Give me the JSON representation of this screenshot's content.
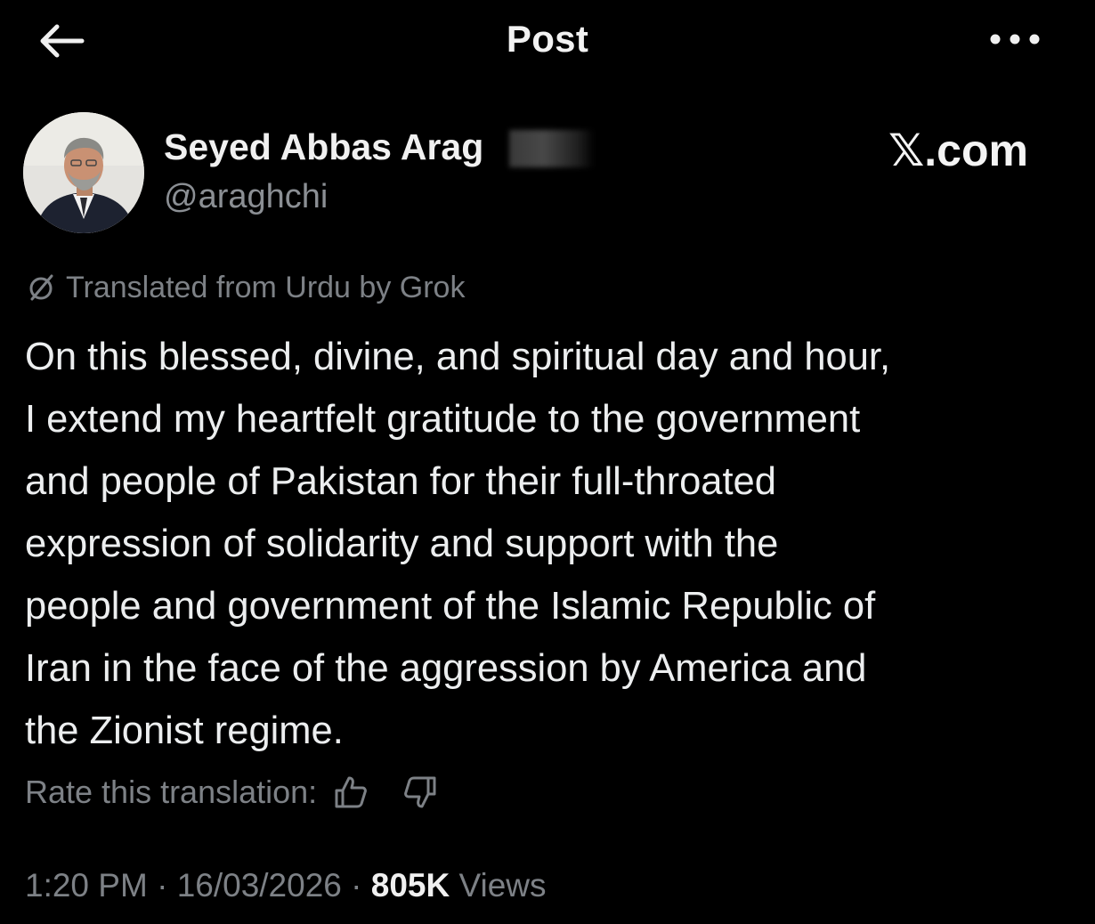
{
  "header": {
    "title": "Post",
    "back_icon": "arrow-left-icon",
    "more_icon": "more-horizontal-icon"
  },
  "author": {
    "name": "Seyed Abbas Arag",
    "handle": "@araghchi"
  },
  "watermark": "𝕏.com",
  "translation_notice": "Translated from Urdu by Grok",
  "post_lines": [
    "On this blessed, divine, and spiritual day and hour,",
    "I extend my heartfelt gratitude to the government",
    "and people of Pakistan for their full-throated",
    "expression of solidarity and support with the",
    "people and government of the Islamic Republic of",
    "Iran in the face of the aggression by America and",
    "the Zionist regime."
  ],
  "rating": {
    "label": "Rate this translation:",
    "up_icon": "thumbs-up-icon",
    "down_icon": "thumbs-down-icon"
  },
  "meta": {
    "time": "1:20 PM",
    "separator": "·",
    "date": "16/03/2026",
    "views_count": "805K",
    "views_label": "Views"
  },
  "colors": {
    "background": "#000000",
    "text_primary": "#e7e9ea",
    "text_secondary": "#7d8186"
  }
}
